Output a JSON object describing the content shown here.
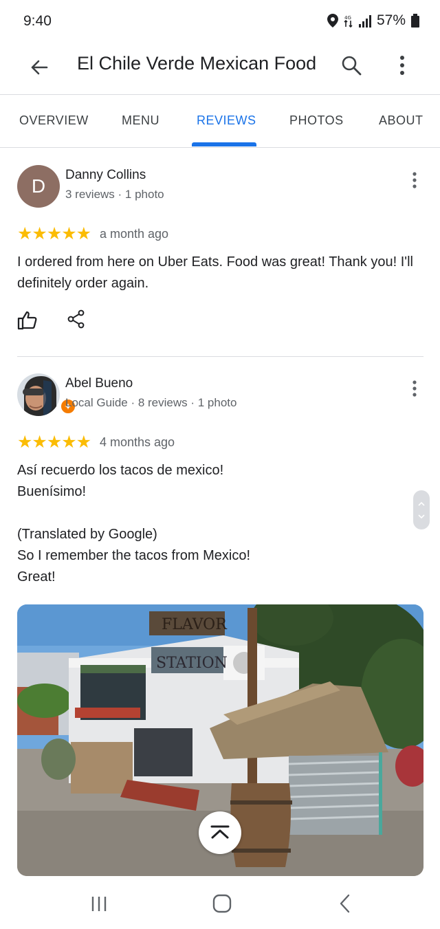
{
  "status_bar": {
    "time": "9:40",
    "battery": "57%"
  },
  "app_bar": {
    "title": "El Chile Verde Mexican Food"
  },
  "tabs": [
    {
      "label": "OVERVIEW",
      "active": false
    },
    {
      "label": "MENU",
      "active": false
    },
    {
      "label": "REVIEWS",
      "active": true
    },
    {
      "label": "PHOTOS",
      "active": false
    },
    {
      "label": "ABOUT",
      "active": false
    }
  ],
  "reviews": [
    {
      "avatar_letter": "D",
      "name": "Danny Collins",
      "meta": "3 reviews · 1 photo",
      "stars": "★★★★★",
      "rating": 5,
      "time_ago": "a month ago",
      "text": "I ordered from here on Uber Eats. Food was great! Thank you! I'll definitely order again."
    },
    {
      "name": "Abel Bueno",
      "meta": "Local Guide · 8 reviews · 1 photo",
      "stars": "★★★★★",
      "rating": 5,
      "time_ago": "4 months ago",
      "text": "Así recuerdo los tacos de mexico!\nBuenísimo!\n\n(Translated by Google)\nSo I remember the tacos from Mexico!\nGreat!",
      "photo_signs": {
        "top": "FLAVOR",
        "bottom": "STATION"
      }
    }
  ],
  "colors": {
    "accent": "#1a73e8",
    "star": "#fbbc04",
    "avatar_bg": "#8d6e63",
    "local_guide": "#f57c00"
  }
}
